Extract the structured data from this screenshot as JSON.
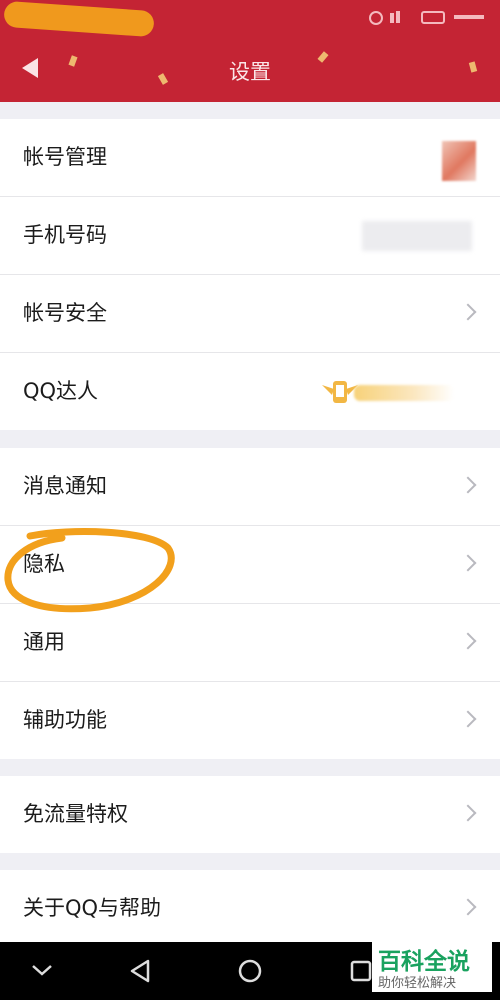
{
  "colors": {
    "header_bg": "#c42434",
    "annotation": "#f2a01c",
    "chevron": "#b9b9bf",
    "watermark_green": "#1aa25f"
  },
  "header": {
    "title": "设置"
  },
  "groups": [
    {
      "items": [
        {
          "label": "帐号管理"
        },
        {
          "label": "手机号码"
        },
        {
          "label": "帐号安全"
        },
        {
          "label": "QQ达人"
        }
      ]
    },
    {
      "items": [
        {
          "label": "消息通知"
        },
        {
          "label": "隐私"
        },
        {
          "label": "通用"
        },
        {
          "label": "辅助功能"
        }
      ]
    },
    {
      "items": [
        {
          "label": "免流量特权"
        }
      ]
    },
    {
      "items": [
        {
          "label": "关于QQ与帮助"
        }
      ]
    }
  ],
  "watermark": {
    "title": "百科全说",
    "subtitle": "助你轻松解决"
  }
}
